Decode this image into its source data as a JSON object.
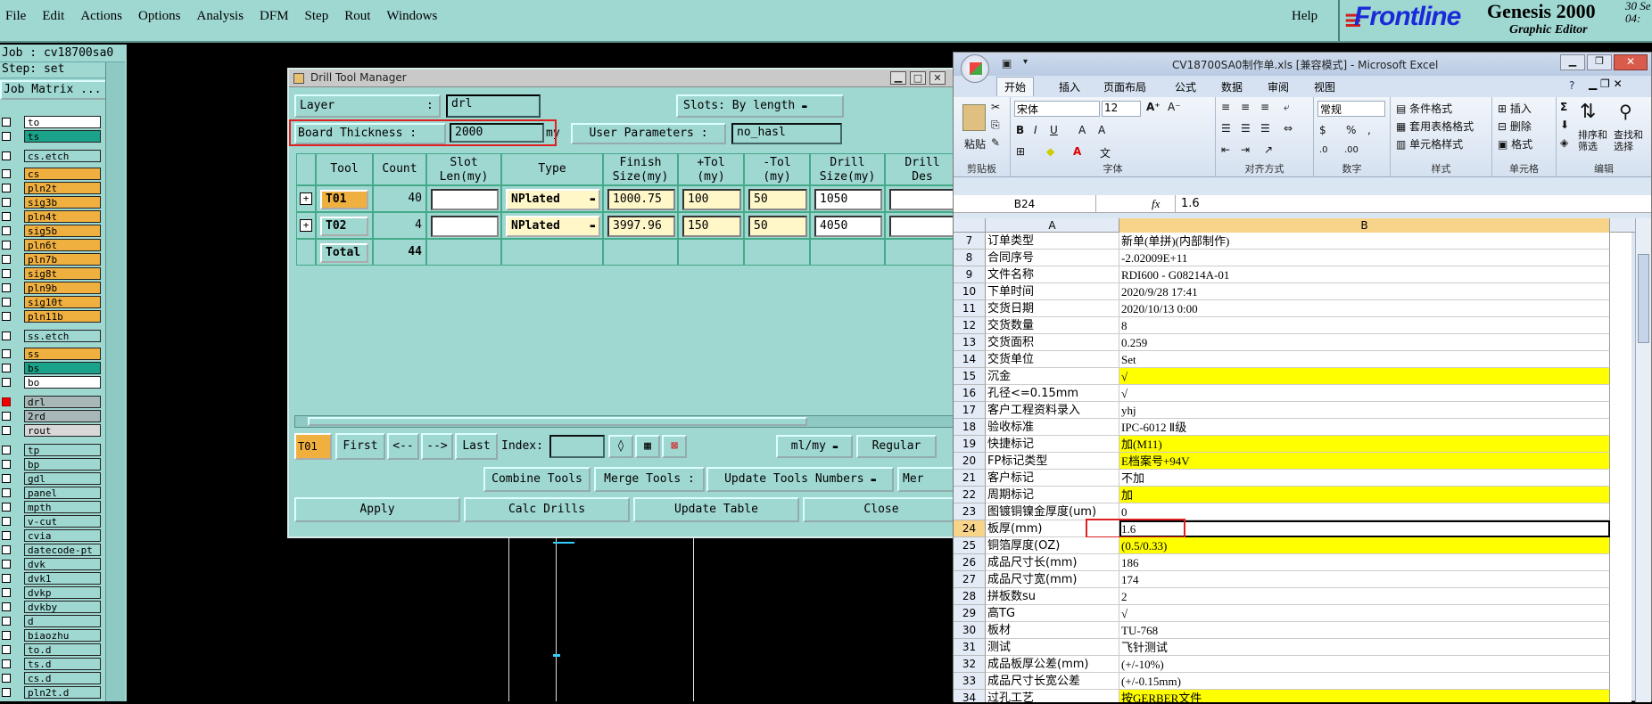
{
  "menu": [
    "File",
    "Edit",
    "Actions",
    "Options",
    "Analysis",
    "DFM",
    "Step",
    "Rout",
    "Windows"
  ],
  "help": "Help",
  "brand": {
    "frontline": "Frontline",
    "product": "Genesis 2000",
    "sub": "Graphic Editor",
    "clock_1": "30 Se",
    "clock_2": "04:"
  },
  "job": {
    "job_line": "Job : cv18700sa0",
    "step_line": "Step: set",
    "matrix": "Job Matrix ..."
  },
  "layers": [
    {
      "name": "to",
      "color": "#ffffff"
    },
    {
      "name": "ts",
      "color": "#1aa38a"
    },
    {
      "name": "cs.etch",
      "color": "#9fd7d1"
    },
    {
      "name": "cs",
      "color": "#f0b040"
    },
    {
      "name": "pln2t",
      "color": "#f0b040"
    },
    {
      "name": "sig3b",
      "color": "#f0b040"
    },
    {
      "name": "pln4t",
      "color": "#f0b040"
    },
    {
      "name": "sig5b",
      "color": "#f0b040"
    },
    {
      "name": "pln6t",
      "color": "#f0b040"
    },
    {
      "name": "pln7b",
      "color": "#f0b040"
    },
    {
      "name": "sig8t",
      "color": "#f0b040"
    },
    {
      "name": "pln9b",
      "color": "#f0b040"
    },
    {
      "name": "sig10t",
      "color": "#f0b040"
    },
    {
      "name": "pln11b",
      "color": "#f0b040"
    },
    {
      "name": "ss.etch",
      "color": "#9fd7d1"
    },
    {
      "name": "ss",
      "color": "#f0b040"
    },
    {
      "name": "bs",
      "color": "#1aa38a"
    },
    {
      "name": "bo",
      "color": "#ffffff"
    },
    {
      "name": "drl",
      "color": "#a8b8b8"
    },
    {
      "name": "2rd",
      "color": "#a8b8b8"
    },
    {
      "name": "rout",
      "color": "#d8d8d8"
    },
    {
      "name": "tp",
      "color": "#9fd7d1"
    },
    {
      "name": "bp",
      "color": "#9fd7d1"
    },
    {
      "name": "gdl",
      "color": "#9fd7d1"
    },
    {
      "name": "panel",
      "color": "#9fd7d1"
    },
    {
      "name": "mpth",
      "color": "#9fd7d1"
    },
    {
      "name": "v-cut",
      "color": "#9fd7d1"
    },
    {
      "name": "cvia",
      "color": "#9fd7d1"
    },
    {
      "name": "datecode-pt",
      "color": "#9fd7d1"
    },
    {
      "name": "dvk",
      "color": "#9fd7d1"
    },
    {
      "name": "dvk1",
      "color": "#9fd7d1"
    },
    {
      "name": "dvkp",
      "color": "#9fd7d1"
    },
    {
      "name": "dvkby",
      "color": "#9fd7d1"
    },
    {
      "name": "d",
      "color": "#9fd7d1"
    },
    {
      "name": "biaozhu",
      "color": "#9fd7d1"
    },
    {
      "name": "to.d",
      "color": "#9fd7d1"
    },
    {
      "name": "ts.d",
      "color": "#9fd7d1"
    },
    {
      "name": "cs.d",
      "color": "#9fd7d1"
    },
    {
      "name": "pln2t.d",
      "color": "#9fd7d1"
    }
  ],
  "dtm": {
    "title": "Drill Tool Manager",
    "layer_label": "Layer",
    "colon": ":",
    "layer_value": "drl",
    "slots_label": "Slots:",
    "slots_value": "By length",
    "thickness_label": "Board Thickness :",
    "thickness_value": "2000",
    "thickness_unit": "my",
    "user_params_label": "User Parameters :",
    "user_params_value": "no_hasl",
    "headers": [
      "Tool",
      "Count",
      "Slot\nLen(my)",
      "Type",
      "Finish\nSize(my)",
      "+Tol\n(my)",
      "-Tol\n(my)",
      "Drill\nSize(my)",
      "Drill\nDes"
    ],
    "rows": [
      {
        "tool": "T01",
        "count": "40",
        "type": "NPlated",
        "finish": "1000.75",
        "ptol": "100",
        "mtol": "50",
        "drill": "1050"
      },
      {
        "tool": "T02",
        "count": "4",
        "type": "NPlated",
        "finish": "3997.96",
        "ptol": "150",
        "mtol": "50",
        "drill": "4050"
      }
    ],
    "total_label": "Total",
    "total_count": "44",
    "nav": {
      "current": "T01",
      "first": "First",
      "prev": "<--",
      "next": "-->",
      "last": "Last",
      "index": "Index:",
      "units": "ml/my",
      "regular": "Regular"
    },
    "combine": "Combine Tools",
    "merge": "Merge Tools :",
    "update_numbers": "Update Tools Numbers",
    "mer": "Mer",
    "apply": "Apply",
    "calc": "Calc Drills",
    "update_table": "Update Table",
    "close": "Close"
  },
  "excel": {
    "title": "CV18700SA0制作单.xls [兼容模式] - Microsoft Excel",
    "tabs": [
      "开始",
      "插入",
      "页面布局",
      "公式",
      "数据",
      "审阅",
      "视图"
    ],
    "groups": [
      "剪贴板",
      "字体",
      "对齐方式",
      "数字",
      "样式",
      "单元格",
      "编辑"
    ],
    "paste": "粘贴",
    "font_name": "宋体",
    "font_size": "12",
    "number_format": "常规",
    "styles": [
      "条件格式",
      "套用表格格式",
      "单元格样式"
    ],
    "cells_btns": [
      "插入",
      "删除",
      "格式"
    ],
    "edit_btns": [
      "排序和\n筛选",
      "查找和\n选择"
    ],
    "name_box": "B24",
    "fx": "fx",
    "formula": "1.6",
    "col_a": "A",
    "col_b": "B",
    "rows": [
      {
        "n": "7",
        "a": "订单类型",
        "b": "新单(单拼)(内部制作)",
        "y": false
      },
      {
        "n": "8",
        "a": "合同序号",
        "b": "-2.02009E+11",
        "y": false
      },
      {
        "n": "9",
        "a": "文件名称",
        "b": "RDI600 - G08214A-01",
        "y": false
      },
      {
        "n": "10",
        "a": "下单时间",
        "b": "2020/9/28 17:41",
        "y": false
      },
      {
        "n": "11",
        "a": "交货日期",
        "b": "2020/10/13 0:00",
        "y": false
      },
      {
        "n": "12",
        "a": "交货数量",
        "b": "8",
        "y": false
      },
      {
        "n": "13",
        "a": "交货面积",
        "b": "0.259",
        "y": false
      },
      {
        "n": "14",
        "a": "交货单位",
        "b": "Set",
        "y": false
      },
      {
        "n": "15",
        "a": "沉金",
        "b": "√",
        "y": true
      },
      {
        "n": "16",
        "a": "孔径<=0.15mm",
        "b": "√",
        "y": false
      },
      {
        "n": "17",
        "a": "客户工程资料录入",
        "b": "yhj",
        "y": false
      },
      {
        "n": "18",
        "a": "验收标准",
        "b": "IPC-6012 Ⅱ级",
        "y": false
      },
      {
        "n": "19",
        "a": "快捷标记",
        "b": "加(M11)",
        "y": true
      },
      {
        "n": "20",
        "a": "FP标记类型",
        "b": "E档案号+94V",
        "y": true
      },
      {
        "n": "21",
        "a": "客户标记",
        "b": "不加",
        "y": false
      },
      {
        "n": "22",
        "a": "周期标记",
        "b": "加",
        "y": true
      },
      {
        "n": "23",
        "a": "图镀铜镍金厚度(um)",
        "b": "0",
        "y": false
      },
      {
        "n": "24",
        "a": "板厚(mm)",
        "b": "1.6",
        "y": false
      },
      {
        "n": "25",
        "a": "铜箔厚度(OZ)",
        "b": "(0.5/0.33)",
        "y": true
      },
      {
        "n": "26",
        "a": "成品尺寸长(mm)",
        "b": "186",
        "y": false
      },
      {
        "n": "27",
        "a": "成品尺寸宽(mm)",
        "b": "174",
        "y": false
      },
      {
        "n": "28",
        "a": "拼板数su",
        "b": "2",
        "y": false
      },
      {
        "n": "29",
        "a": "高TG",
        "b": "√",
        "y": false
      },
      {
        "n": "30",
        "a": "板材",
        "b": "TU-768",
        "y": false
      },
      {
        "n": "31",
        "a": "测试",
        "b": "飞针测试",
        "y": false
      },
      {
        "n": "32",
        "a": "成品板厚公差(mm)",
        "b": "(+/-10%)",
        "y": false
      },
      {
        "n": "33",
        "a": "成品尺寸长宽公差",
        "b": "(+/-0.15mm)",
        "y": false
      },
      {
        "n": "34",
        "a": "过孔工艺",
        "b": "按GERBER文件",
        "y": true
      }
    ]
  }
}
